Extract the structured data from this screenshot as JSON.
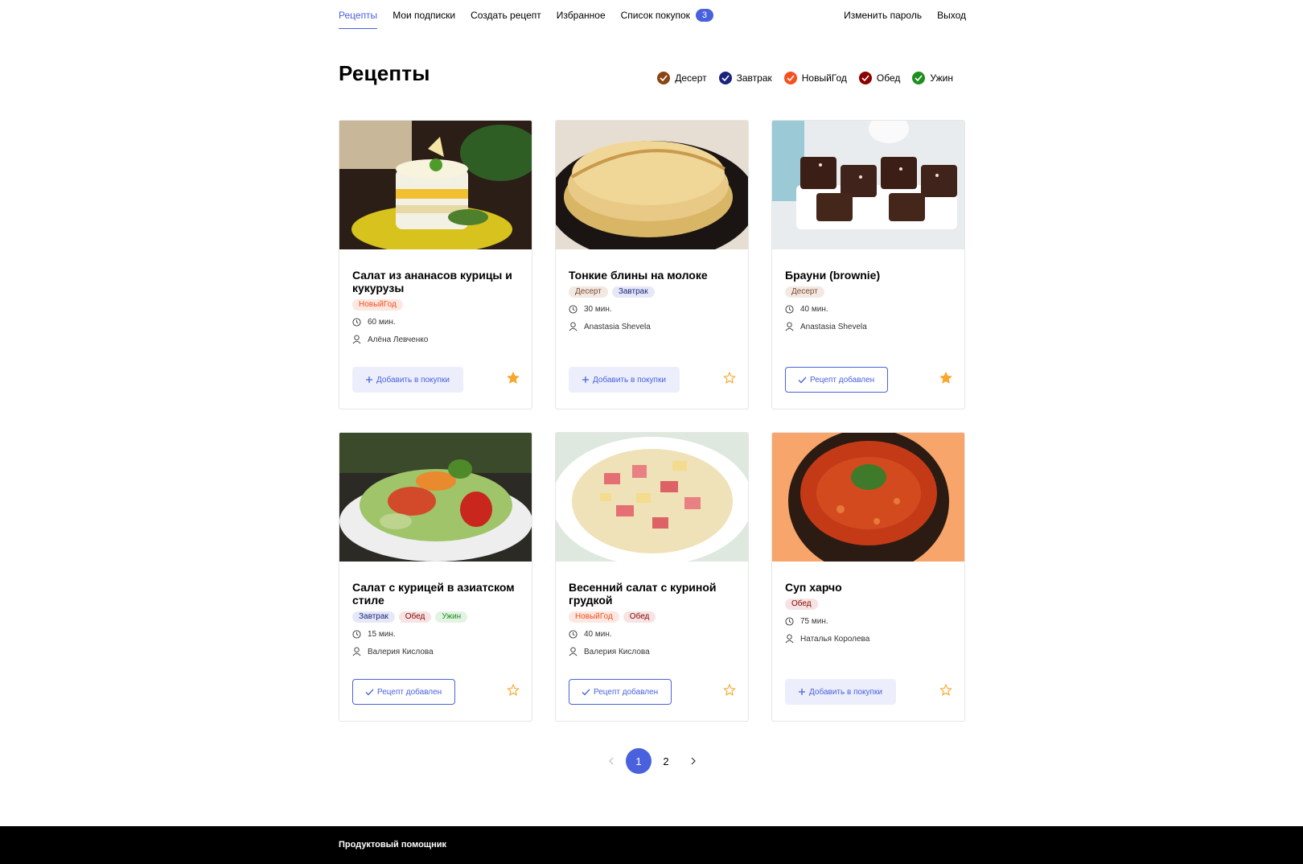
{
  "nav": {
    "items": [
      {
        "label": "Рецепты"
      },
      {
        "label": "Мои подписки"
      },
      {
        "label": "Создать рецепт"
      },
      {
        "label": "Избранное"
      },
      {
        "label": "Список покупок",
        "badge": "3"
      }
    ],
    "right": [
      {
        "label": "Изменить пароль"
      },
      {
        "label": "Выход"
      }
    ]
  },
  "page": {
    "title": "Рецепты",
    "filters": [
      {
        "label": "Десерт",
        "color": "#8b4513"
      },
      {
        "label": "Завтрак",
        "color": "#1a237e"
      },
      {
        "label": "НовыйГод",
        "color": "#f4511e"
      },
      {
        "label": "Обед",
        "color": "#8b0000"
      },
      {
        "label": "Ужин",
        "color": "#1e8e1e"
      }
    ]
  },
  "recipes": [
    {
      "title": "Салат из ананасов курицы и кукурузы",
      "image": "salad-pineapple",
      "tags": [
        {
          "label": "НовыйГод",
          "bg": "#fde7e1",
          "fg": "#f4511e"
        }
      ],
      "time": "60 мин.",
      "author": "Алёна Левченко",
      "button": "Добавить в покупки",
      "in_cart": false,
      "favorite": true
    },
    {
      "title": "Тонкие блины на молоке",
      "image": "pancakes",
      "tags": [
        {
          "label": "Десерт",
          "bg": "#f3e9e3",
          "fg": "#7a4a2e"
        },
        {
          "label": "Завтрак",
          "bg": "#e6e8f7",
          "fg": "#1a237e"
        }
      ],
      "time": "30 мин.",
      "author": "Anastasia Shevela",
      "button": "Добавить в покупки",
      "in_cart": false,
      "favorite": false
    },
    {
      "title": "Брауни (brownie)",
      "image": "brownie",
      "tags": [
        {
          "label": "Десерт",
          "bg": "#f3e9e3",
          "fg": "#7a4a2e"
        }
      ],
      "time": "40 мин.",
      "author": "Anastasia Shevela",
      "button": "Рецепт добавлен",
      "in_cart": true,
      "favorite": true
    },
    {
      "title": "Салат с курицей в азиатском стиле",
      "image": "asian-salad",
      "tags": [
        {
          "label": "Завтрак",
          "bg": "#e6e8f7",
          "fg": "#1a237e"
        },
        {
          "label": "Обед",
          "bg": "#f6e3e3",
          "fg": "#8b0000"
        },
        {
          "label": "Ужин",
          "bg": "#e3f3e3",
          "fg": "#1e8e1e"
        }
      ],
      "time": "15 мин.",
      "author": "Валерия Кислова",
      "button": "Рецепт добавлен",
      "in_cart": true,
      "favorite": false
    },
    {
      "title": "Весенний салат с куриной грудкой",
      "image": "spring-salad",
      "tags": [
        {
          "label": "НовыйГод",
          "bg": "#fde7e1",
          "fg": "#f4511e"
        },
        {
          "label": "Обед",
          "bg": "#f6e3e3",
          "fg": "#8b0000"
        }
      ],
      "time": "40 мин.",
      "author": "Валерия Кислова",
      "button": "Рецепт добавлен",
      "in_cart": true,
      "favorite": false
    },
    {
      "title": "Суп харчо",
      "image": "kharcho",
      "tags": [
        {
          "label": "Обед",
          "bg": "#f6e3e3",
          "fg": "#8b0000"
        }
      ],
      "time": "75 мин.",
      "author": "Наталья Королева",
      "button": "Добавить в покупки",
      "in_cart": false,
      "favorite": false
    }
  ],
  "pagination": {
    "pages": [
      "1",
      "2"
    ],
    "current": "1"
  },
  "footer": {
    "text": "Продуктовый помощник"
  },
  "colors": {
    "accent": "#4a61dd",
    "star": "#f9a62b"
  }
}
